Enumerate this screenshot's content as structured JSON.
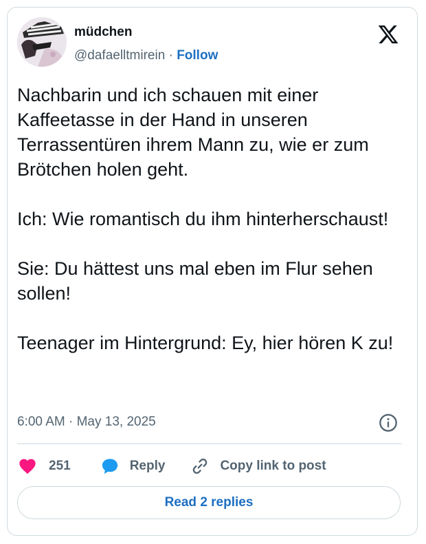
{
  "user": {
    "display_name": "müdchen",
    "handle": "@dafaelltmirein",
    "separator": "·",
    "follow_label": "Follow"
  },
  "tweet": {
    "paragraphs": [
      "Nachbarin und ich schauen mit einer Kaffeetasse in der Hand in unseren Terrassentüren ihrem Mann zu, wie er zum Brötchen holen geht.",
      "Ich: Wie romantisch du ihm hinterherschaust!",
      "Sie: Du hättest uns mal eben im Flur sehen sollen!",
      "Teenager im Hintergrund: Ey, hier hören K zu!"
    ],
    "timestamp": "6:00 AM · May 13, 2025"
  },
  "actions": {
    "like_count": "251",
    "reply_label": "Reply",
    "copy_label": "Copy link to post"
  },
  "footer": {
    "read_replies_label": "Read 2 replies"
  },
  "colors": {
    "like": "#f91880",
    "reply": "#1d9bf0",
    "link": "#1d6fc2",
    "muted": "#536471",
    "border": "#cfd9de"
  },
  "icons": [
    "x-logo-icon",
    "info-icon",
    "heart-icon",
    "reply-bubble-icon",
    "link-icon"
  ]
}
